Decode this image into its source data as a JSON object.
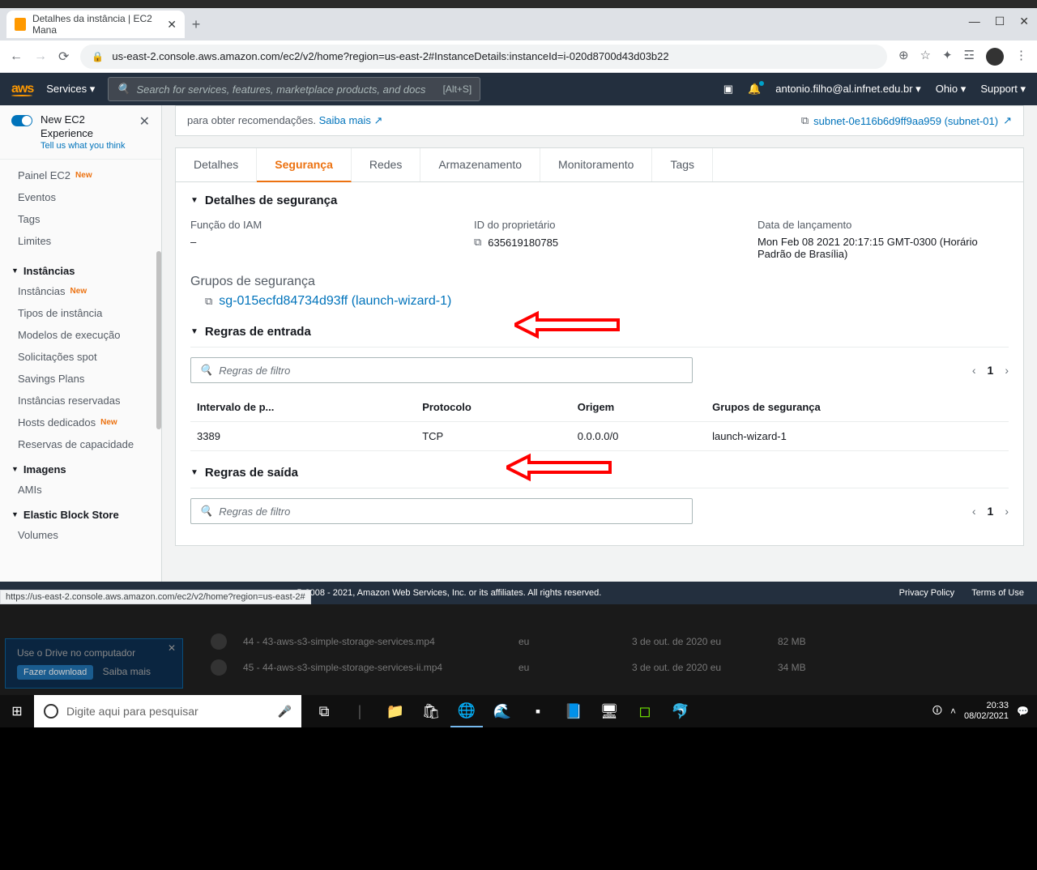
{
  "browser": {
    "tab_title": "Detalhes da instância | EC2 Mana",
    "url": "us-east-2.console.aws.amazon.com/ec2/v2/home?region=us-east-2#InstanceDetails:instanceId=i-020d8700d43d03b22",
    "status_url": "https://us-east-2.console.aws.amazon.com/ec2/v2/home?region=us-east-2#"
  },
  "aws_header": {
    "logo": "aws",
    "services": "Services",
    "search_placeholder": "Search for services, features, marketplace products, and docs",
    "search_shortcut": "[Alt+S]",
    "account": "antonio.filho@al.infnet.edu.br",
    "region": "Ohio",
    "support": "Support"
  },
  "sidebar": {
    "new_exp_title": "New EC2 Experience",
    "new_exp_feedback": "Tell us what you think",
    "top_items": [
      {
        "label": "Painel EC2",
        "new": true
      },
      {
        "label": "Eventos"
      },
      {
        "label": "Tags"
      },
      {
        "label": "Limites"
      }
    ],
    "groups": [
      {
        "heading": "Instâncias",
        "items": [
          {
            "label": "Instâncias",
            "new": true
          },
          {
            "label": "Tipos de instância"
          },
          {
            "label": "Modelos de execução"
          },
          {
            "label": "Solicitações spot"
          },
          {
            "label": "Savings Plans"
          },
          {
            "label": "Instâncias reservadas"
          },
          {
            "label": "Hosts dedicados",
            "new": true
          },
          {
            "label": "Reservas de capacidade"
          }
        ]
      },
      {
        "heading": "Imagens",
        "items": [
          {
            "label": "AMIs"
          }
        ]
      },
      {
        "heading": "Elastic Block Store",
        "items": [
          {
            "label": "Volumes"
          }
        ]
      }
    ],
    "new_badge": "New"
  },
  "banner": {
    "text": "para obter recomendações.",
    "learn_more": "Saiba mais",
    "subnet_label": "subnet-0e116b6d9ff9aa959 (subnet-01)"
  },
  "tabs": [
    "Detalhes",
    "Segurança",
    "Redes",
    "Armazenamento",
    "Monitoramento",
    "Tags"
  ],
  "active_tab": 1,
  "security": {
    "heading": "Detalhes de segurança",
    "iam_label": "Função do IAM",
    "iam_value": "–",
    "owner_label": "ID do proprietário",
    "owner_value": "635619180785",
    "launch_label": "Data de lançamento",
    "launch_value": "Mon Feb 08 2021 20:17:15 GMT-0300 (Horário Padrão de Brasília)",
    "sg_label": "Grupos de segurança",
    "sg_link": "sg-015ecfd84734d93ff (launch-wizard-1)",
    "inbound_heading": "Regras de entrada",
    "outbound_heading": "Regras de saída",
    "filter_placeholder": "Regras de filtro",
    "page": "1",
    "table_headers": [
      "Intervalo de p...",
      "Protocolo",
      "Origem",
      "Grupos de segurança"
    ],
    "table_row": [
      "3389",
      "TCP",
      "0.0.0.0/0",
      "launch-wizard-1"
    ]
  },
  "footer": {
    "copyright": "© 2008 - 2021, Amazon Web Services, Inc. or its affiliates. All rights reserved.",
    "privacy": "Privacy Policy",
    "terms": "Terms of Use"
  },
  "bg_files": [
    {
      "name": "44 - 43-aws-s3-simple-storage-services.mp4",
      "owner": "eu",
      "date": "3 de out. de 2020 eu",
      "size": "82 MB"
    },
    {
      "name": "45 - 44-aws-s3-simple-storage-services-ii.mp4",
      "owner": "eu",
      "date": "3 de out. de 2020 eu",
      "size": "34 MB"
    }
  ],
  "drive": {
    "title": "Use o Drive no computador",
    "download": "Fazer download",
    "more": "Saiba mais"
  },
  "taskbar": {
    "search_placeholder": "Digite aqui para pesquisar",
    "time": "20:33",
    "date": "08/02/2021"
  }
}
